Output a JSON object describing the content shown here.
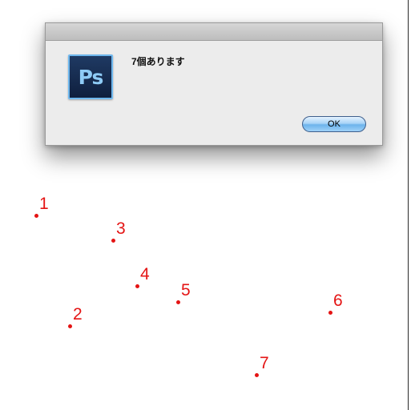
{
  "dialog": {
    "app_icon_text": "Ps",
    "message": "7個あります",
    "ok_label": "OK"
  },
  "markers": [
    {
      "label": "1"
    },
    {
      "label": "2"
    },
    {
      "label": "3"
    },
    {
      "label": "4"
    },
    {
      "label": "5"
    },
    {
      "label": "6"
    },
    {
      "label": "7"
    }
  ],
  "colors": {
    "marker": "#e41414",
    "dialog_background": "#ececec",
    "icon_background": "#1f3a63",
    "icon_text": "#8ecbf6",
    "button_blue": "#6cb3ec"
  },
  "icons": {
    "app_icon": "photoshop-icon"
  }
}
